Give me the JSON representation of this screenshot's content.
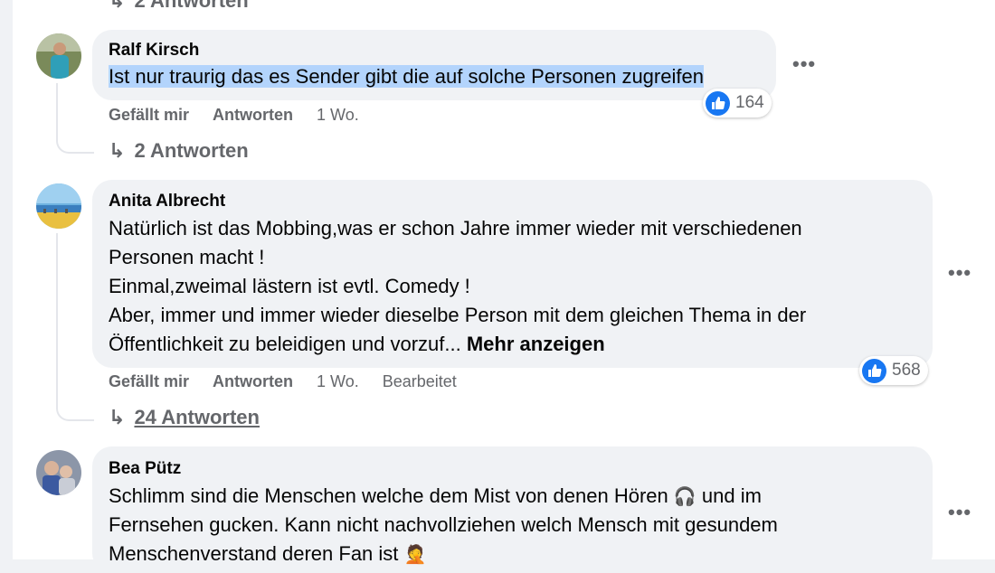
{
  "top_replies": {
    "label": "2 Antworten"
  },
  "comments": [
    {
      "author": "Ralf Kirsch",
      "lines": [
        "Ist nur traurig das es Sender gibt die auf solche Personen zugreifen"
      ],
      "actions": {
        "like": "Gefällt mir",
        "reply": "Antworten",
        "time": "1 Wo."
      },
      "reaction_count": "164",
      "replies": "2 Antworten"
    },
    {
      "author": "Anita Albrecht",
      "lines": [
        "Natürlich ist das Mobbing,was er schon Jahre immer wieder mit verschiedenen",
        "Personen macht !",
        "Einmal,zweimal lästern ist evtl. Comedy !",
        "Aber, immer und immer wieder dieselbe Person mit dem gleichen Thema in der",
        "Öffentlichkeit zu beleidigen und vorzuf..."
      ],
      "see_more": "Mehr anzeigen",
      "actions": {
        "like": "Gefällt mir",
        "reply": "Antworten",
        "time": "1 Wo.",
        "edited": "Bearbeitet"
      },
      "reaction_count": "568",
      "replies": "24 Antworten"
    },
    {
      "author": "Bea Pütz",
      "lines": [
        "Schlimm sind die Menschen welche dem Mist von denen Hören",
        "und im",
        "Fernsehen gucken. Kann nicht nachvollziehen welch Mensch mit gesundem",
        "Menschenverstand deren Fan ist"
      ]
    }
  ],
  "colors": {
    "like_blue": "#1877f2",
    "bubble": "#f0f2f5",
    "muted": "#65676b",
    "selection": "#b3d4fc"
  },
  "icons": {
    "like": "thumbs-up-icon",
    "menu": "more-options-icon",
    "reply_arrow": "reply-arrow-icon"
  }
}
